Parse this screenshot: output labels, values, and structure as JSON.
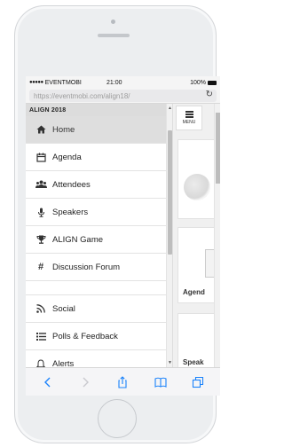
{
  "status_bar": {
    "signal": "●●●●●",
    "carrier": "EVENTMOBI",
    "time": "21:00",
    "battery": "100%"
  },
  "browser": {
    "url": "https://eventmobi.com/align18/"
  },
  "menu": {
    "header": "ALIGN 2018",
    "items": [
      {
        "label": "Home",
        "icon": "home-icon",
        "active": true
      },
      {
        "label": "Agenda",
        "icon": "calendar-icon"
      },
      {
        "label": "Attendees",
        "icon": "people-icon"
      },
      {
        "label": "Speakers",
        "icon": "microphone-icon"
      },
      {
        "label": "ALIGN Game",
        "icon": "trophy-icon"
      },
      {
        "label": "Discussion Forum",
        "icon": "hashtag-icon"
      },
      {
        "label": "Social",
        "icon": "rss-icon"
      },
      {
        "label": "Polls & Feedback",
        "icon": "list-icon"
      },
      {
        "label": "Alerts",
        "icon": "bell-icon"
      }
    ]
  },
  "side_panel": {
    "menu_label": "MENU",
    "tile_agenda": "Agend",
    "tile_speakers": "Speak"
  },
  "colors": {
    "accent": "#1a82fb",
    "header_bg": "#dcdcdc"
  }
}
